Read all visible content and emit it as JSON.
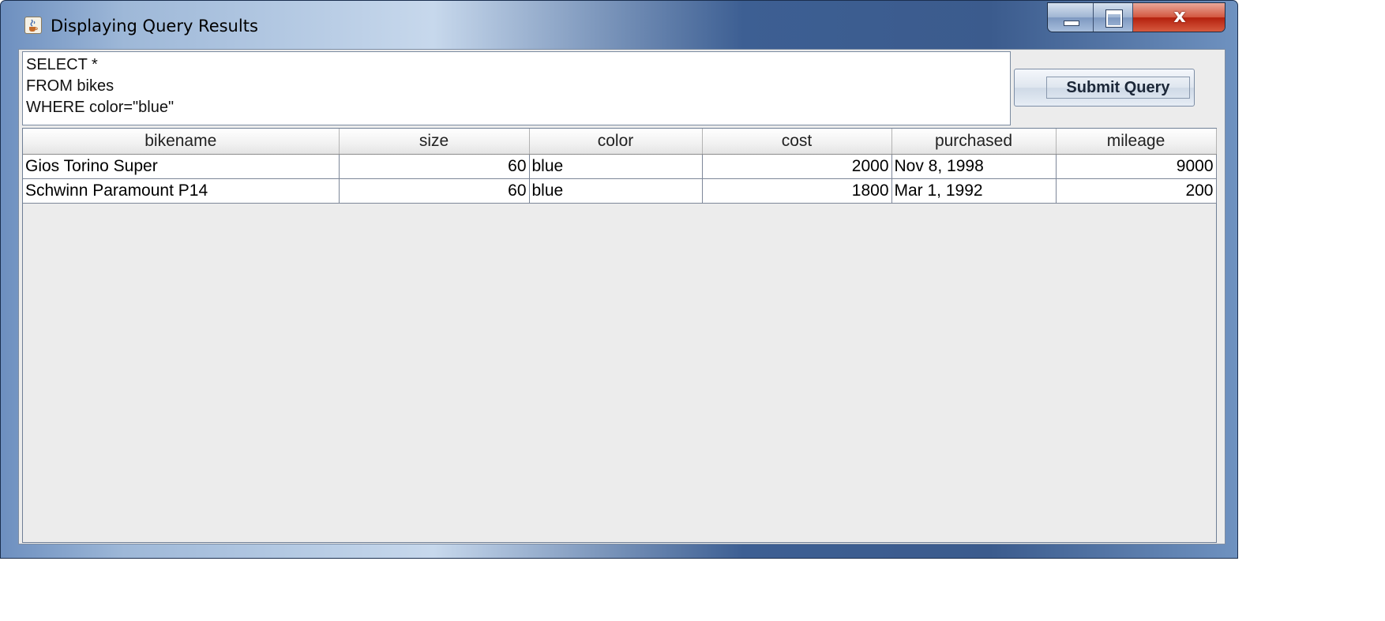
{
  "window": {
    "title": "Displaying Query Results",
    "close_glyph": "x",
    "icon": "java-cup-icon"
  },
  "query": {
    "lines": [
      "SELECT *",
      "FROM bikes",
      "WHERE color=\"blue\""
    ]
  },
  "submit_label": "Submit Query",
  "results": {
    "columns": [
      "bikename",
      "size",
      "color",
      "cost",
      "purchased",
      "mileage"
    ],
    "rows": [
      [
        "Gios Torino Super",
        "60",
        "blue",
        "2000",
        "Nov 8, 1998",
        "9000"
      ],
      [
        "Schwinn Paramount P14",
        "60",
        "blue",
        "1800",
        "Mar 1, 1992",
        "200"
      ]
    ]
  }
}
